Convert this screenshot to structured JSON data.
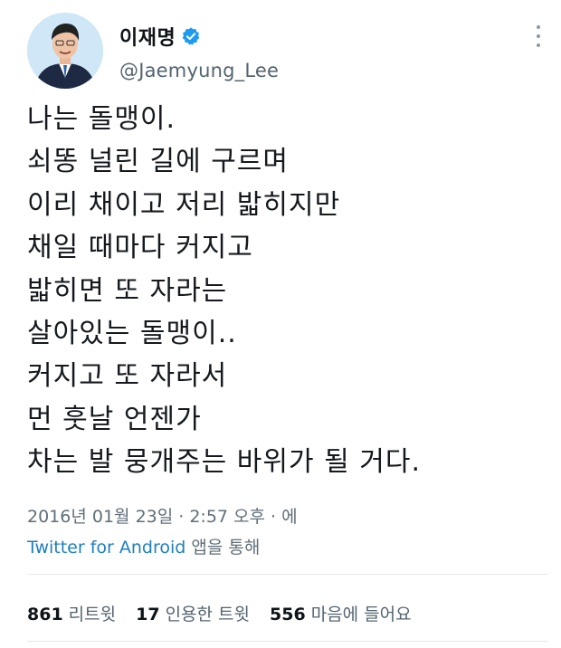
{
  "author": {
    "name": "이재명",
    "handle": "@Jaemyung_Lee",
    "verified": true
  },
  "tweet": {
    "lines": [
      "나는 돌맹이.",
      "쇠똥 널린 길에 구르며",
      "이리 채이고 저리 밟히지만",
      "채일 때마다 커지고",
      "밟히면 또 자라는",
      "살아있는 돌맹이..",
      "커지고 또 자라서",
      "먼 훗날 언젠가",
      "차는 발 뭉개주는 바위가 될 거다."
    ]
  },
  "meta": {
    "timestamp": "2016년 01월 23일 · 2:57 오후 · 에",
    "source_link": "Twitter for Android",
    "source_suffix": " 앱을 통해"
  },
  "stats": {
    "retweets_count": "861",
    "retweets_label": "리트윗",
    "quotes_count": "17",
    "quotes_label": "인용한 트윗",
    "likes_count": "556",
    "likes_label": "마음에 들어요"
  },
  "colors": {
    "verified": "#1d9bf0",
    "link": "#1d7fc1",
    "muted": "#606e78"
  },
  "icons": {
    "verified": "verified-badge-icon",
    "more": "more-options-icon"
  }
}
